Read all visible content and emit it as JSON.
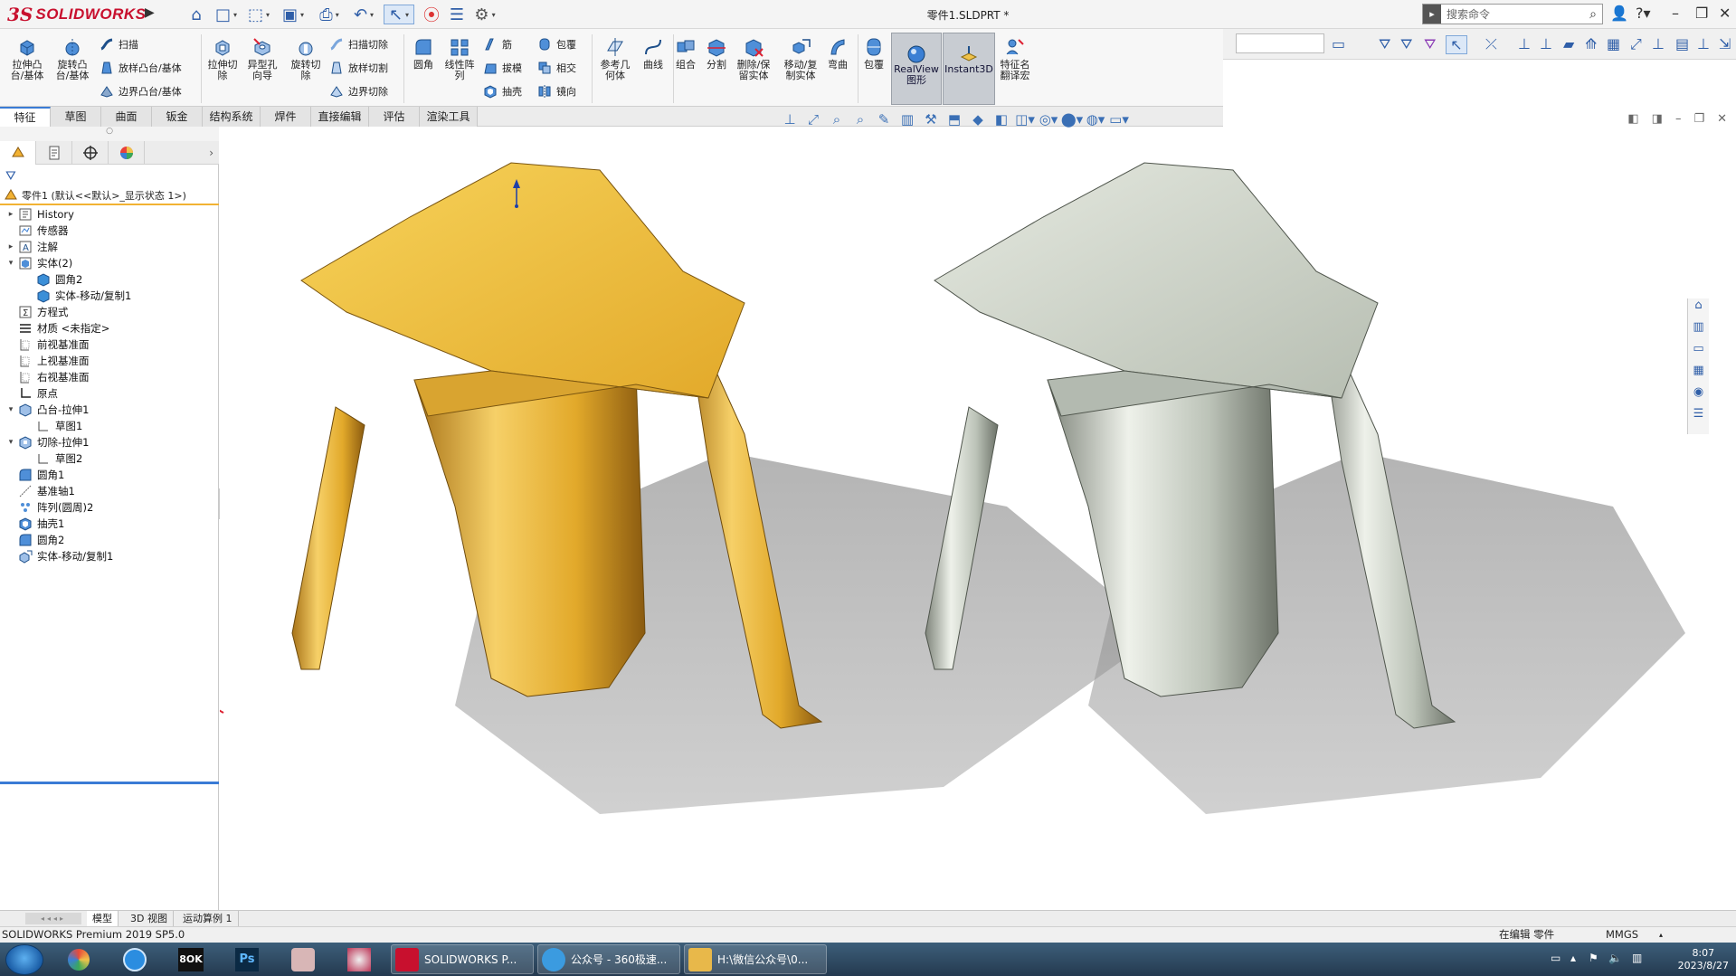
{
  "app": {
    "brand_prefix": "3S",
    "brand_name": "SOLIDWORKS",
    "document_title": "零件1.SLDPRT *"
  },
  "search": {
    "placeholder": "搜索命令"
  },
  "command_manager": {
    "big_buttons": [
      {
        "id": "extrude-boss",
        "label": "拉伸凸\n台/基体"
      },
      {
        "id": "revolve-boss",
        "label": "旋转凸\n台/基体"
      },
      {
        "id": "extrude-cut",
        "label": "拉伸切\n除"
      },
      {
        "id": "hole-wizard",
        "label": "异型孔\n向导"
      },
      {
        "id": "revolve-cut",
        "label": "旋转切\n除"
      },
      {
        "id": "fillet",
        "label": "圆角"
      },
      {
        "id": "linear-pattern",
        "label": "线性阵\n列"
      },
      {
        "id": "reference-geometry",
        "label": "参考几\n何体"
      },
      {
        "id": "curves",
        "label": "曲线"
      },
      {
        "id": "combine",
        "label": "组合"
      },
      {
        "id": "split",
        "label": "分割"
      },
      {
        "id": "delete-keep-body",
        "label": "删除/保\n留实体"
      },
      {
        "id": "move-copy-body",
        "label": "移动/复\n制实体"
      },
      {
        "id": "flex",
        "label": "弯曲"
      },
      {
        "id": "wrap",
        "label": "包覆"
      },
      {
        "id": "realview",
        "label": "RealView\n图形"
      },
      {
        "id": "instant3d",
        "label": "Instant3D"
      },
      {
        "id": "feature-translator",
        "label": "特征名\n翻译宏"
      }
    ],
    "small_buttons": {
      "sweep": "扫描",
      "loft_boss": "放样凸台/基体",
      "boundary_boss": "边界凸台/基体",
      "swept_cut": "扫描切除",
      "lofted_cut": "放样切割",
      "boundary_cut": "边界切除",
      "rib": "筋",
      "draft": "拔模",
      "shell": "抽壳",
      "wrap": "包覆",
      "intersect": "相交",
      "mirror": "镜向"
    }
  },
  "tabs": [
    "特征",
    "草图",
    "曲面",
    "钣金",
    "结构系统",
    "焊件",
    "直接编辑",
    "评估",
    "渲染工具"
  ],
  "active_tab": "特征",
  "feature_tree": {
    "root": "零件1  (默认<<默认>_显示状态 1>)",
    "items": [
      {
        "label": "History",
        "twisty": "▸",
        "indent": 0,
        "icon": "history"
      },
      {
        "label": "传感器",
        "twisty": "",
        "indent": 0,
        "icon": "sensor"
      },
      {
        "label": "注解",
        "twisty": "▸",
        "indent": 0,
        "icon": "annotation"
      },
      {
        "label": "实体(2)",
        "twisty": "▾",
        "indent": 0,
        "icon": "solid-bodies"
      },
      {
        "label": "圆角2",
        "twisty": "",
        "indent": 1,
        "icon": "body"
      },
      {
        "label": "实体-移动/复制1",
        "twisty": "",
        "indent": 1,
        "icon": "body"
      },
      {
        "label": "方程式",
        "twisty": "",
        "indent": 0,
        "icon": "equation"
      },
      {
        "label": "材质 <未指定>",
        "twisty": "",
        "indent": 0,
        "icon": "material"
      },
      {
        "label": "前视基准面",
        "twisty": "",
        "indent": 0,
        "icon": "plane"
      },
      {
        "label": "上视基准面",
        "twisty": "",
        "indent": 0,
        "icon": "plane"
      },
      {
        "label": "右视基准面",
        "twisty": "",
        "indent": 0,
        "icon": "plane"
      },
      {
        "label": "原点",
        "twisty": "",
        "indent": 0,
        "icon": "origin"
      },
      {
        "label": "凸台-拉伸1",
        "twisty": "▾",
        "indent": 0,
        "icon": "boss-extrude"
      },
      {
        "label": "草图1",
        "twisty": "",
        "indent": 1,
        "icon": "sketch"
      },
      {
        "label": "切除-拉伸1",
        "twisty": "▾",
        "indent": 0,
        "icon": "cut-extrude"
      },
      {
        "label": "草图2",
        "twisty": "",
        "indent": 1,
        "icon": "sketch"
      },
      {
        "label": "圆角1",
        "twisty": "",
        "indent": 0,
        "icon": "fillet"
      },
      {
        "label": "基准轴1",
        "twisty": "",
        "indent": 0,
        "icon": "axis"
      },
      {
        "label": "阵列(圆周)2",
        "twisty": "",
        "indent": 0,
        "icon": "circular-pattern"
      },
      {
        "label": "抽壳1",
        "twisty": "",
        "indent": 0,
        "icon": "shell"
      },
      {
        "label": "圆角2",
        "twisty": "",
        "indent": 0,
        "icon": "fillet"
      },
      {
        "label": "实体-移动/复制1",
        "twisty": "",
        "indent": 0,
        "icon": "move-copy"
      }
    ]
  },
  "bottom_tabs": [
    "模型",
    "3D 视图",
    "运动算例 1"
  ],
  "status_bar": {
    "product": "SOLIDWORKS Premium 2019 SP5.0",
    "mode": "在编辑 零件",
    "units": "MMGS"
  },
  "taskbar": {
    "windows": [
      {
        "label": "SOLIDWORKS P...",
        "icon_color": "#c8102e"
      },
      {
        "label": "公众号 - 360极速...",
        "icon_color": "#3b9be0"
      },
      {
        "label": "H:\\微信公众号\\0...",
        "icon_color": "#e8b84a"
      }
    ],
    "time": "8:07",
    "date": "2023/8/27"
  },
  "colors": {
    "gold_body": "#e6b83a",
    "silver_body": "#c3c9be",
    "accent": "#3a7bd5",
    "brand": "#c8102e"
  }
}
